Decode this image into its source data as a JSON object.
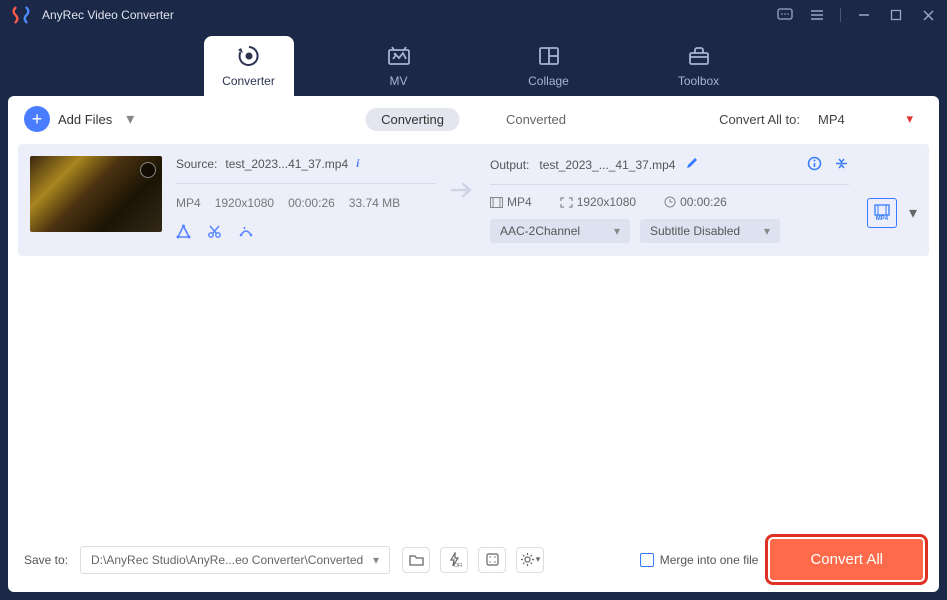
{
  "app": {
    "title": "AnyRec Video Converter"
  },
  "tabs": [
    {
      "label": "Converter"
    },
    {
      "label": "MV"
    },
    {
      "label": "Collage"
    },
    {
      "label": "Toolbox"
    }
  ],
  "toolbar": {
    "add_files": "Add Files",
    "center_tabs": {
      "converting": "Converting",
      "converted": "Converted"
    },
    "convert_all_to_label": "Convert All to:",
    "convert_all_to_value": "MP4"
  },
  "file": {
    "source_label": "Source:",
    "source_name": "test_2023...41_37.mp4",
    "format": "MP4",
    "resolution": "1920x1080",
    "duration": "00:00:26",
    "size": "33.74 MB",
    "output_label": "Output:",
    "output_name": "test_2023_..._41_37.mp4",
    "out_format": "MP4",
    "out_resolution": "1920x1080",
    "out_duration": "00:00:26",
    "audio_select": "AAC-2Channel",
    "subtitle_select": "Subtitle Disabled",
    "badge": "MP4"
  },
  "footer": {
    "save_to_label": "Save to:",
    "save_path": "D:\\AnyRec Studio\\AnyRe...eo Converter\\Converted",
    "merge_label": "Merge into one file",
    "convert_button": "Convert All"
  }
}
